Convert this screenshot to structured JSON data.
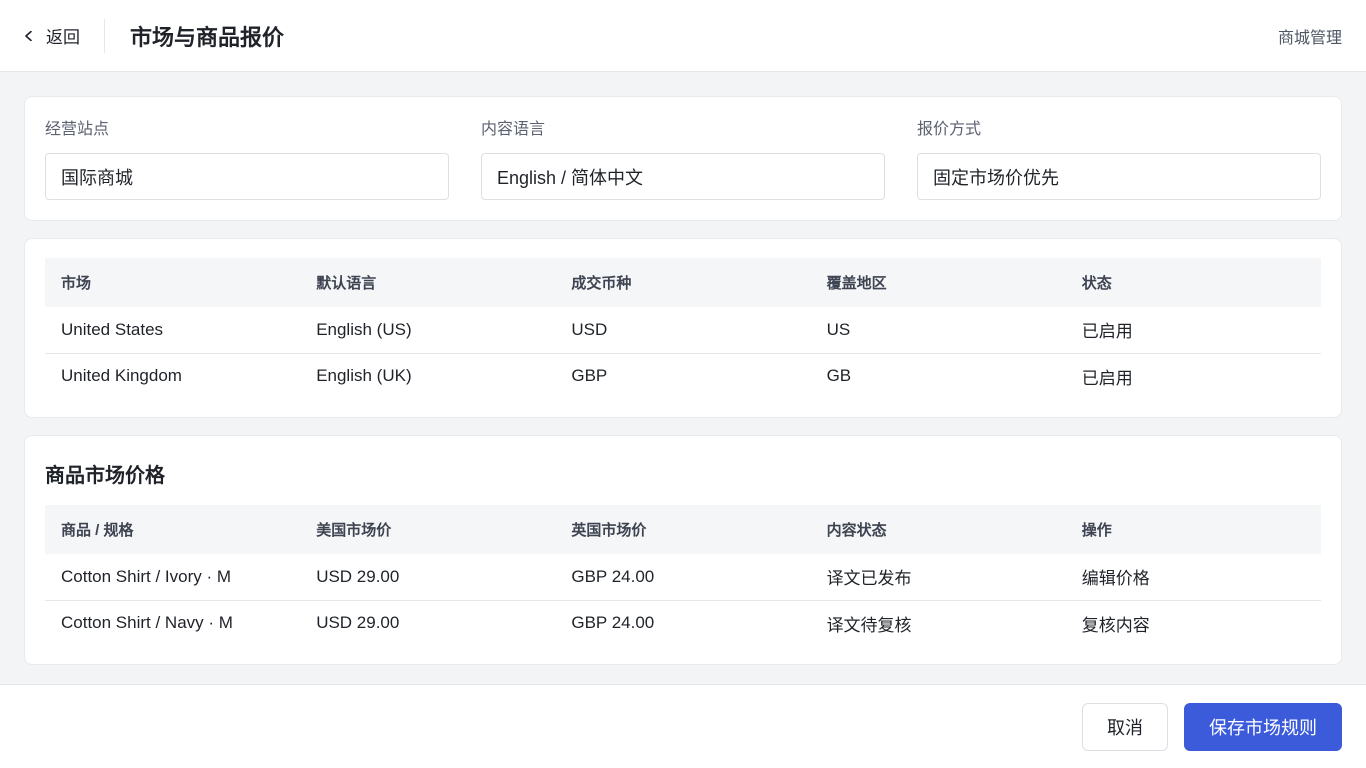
{
  "header": {
    "back_label": "返回",
    "title": "市场与商品报价",
    "right_link": "商城管理"
  },
  "filters": [
    {
      "label": "经营站点",
      "value": "国际商城"
    },
    {
      "label": "内容语言",
      "value": "English / 简体中文"
    },
    {
      "label": "报价方式",
      "value": "固定市场价优先"
    }
  ],
  "markets": {
    "columns": [
      "市场",
      "默认语言",
      "成交币种",
      "覆盖地区",
      "状态"
    ],
    "rows": [
      [
        "United States",
        "English (US)",
        "USD",
        "US",
        "已启用"
      ],
      [
        "United Kingdom",
        "English (UK)",
        "GBP",
        "GB",
        "已启用"
      ]
    ]
  },
  "products": {
    "title": "商品市场价格",
    "columns": [
      "商品 / 规格",
      "美国市场价",
      "英国市场价",
      "内容状态",
      "操作"
    ],
    "rows": [
      [
        "Cotton Shirt / Ivory · M",
        "USD 29.00",
        "GBP 24.00",
        "译文已发布",
        "编辑价格"
      ],
      [
        "Cotton Shirt / Navy · M",
        "USD 29.00",
        "GBP 24.00",
        "译文待复核",
        "复核内容"
      ]
    ]
  },
  "footer": {
    "cancel_label": "取消",
    "save_label": "保存市场规则"
  },
  "colors": {
    "primary": "#3b5bdb",
    "background": "#f3f4f6",
    "table_header": "#f5f6f8"
  }
}
